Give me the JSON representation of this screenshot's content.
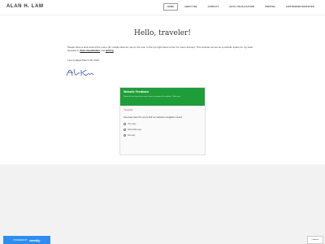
{
  "header": {
    "brand": "ALAN H. LAM",
    "nav": [
      "HOME",
      "ABOUT ME",
      "CONTACT",
      "DATA VISUALIZATION",
      "WRITING",
      "CRITTENDEN REVISITED"
    ]
  },
  "main": {
    "title": "Hello, traveler!",
    "intro_prefix": "Please have a look around the menu (for mobile devices, tap on the icon in the top right-hand corner for menu access). This website serves as a portfolio space for my work samples in ",
    "link1": "data visualization",
    "intro_mid": " and ",
    "link2": "writing",
    "intro_end": ".",
    "updated": "Last updated March 28, 2022"
  },
  "form": {
    "title": "Website Feedback",
    "subtitle": "Please let me know how easy it was to navigate this website. Thank you!",
    "required": "* Required",
    "question": "How easy was it for you to find our website's navigation menu?",
    "options": [
      "Very easy",
      "Somewhat easy",
      "Not easy"
    ]
  },
  "footer": {
    "powered_by": "POWERED BY",
    "weebly": "weebly",
    "badge": "Feedback"
  }
}
